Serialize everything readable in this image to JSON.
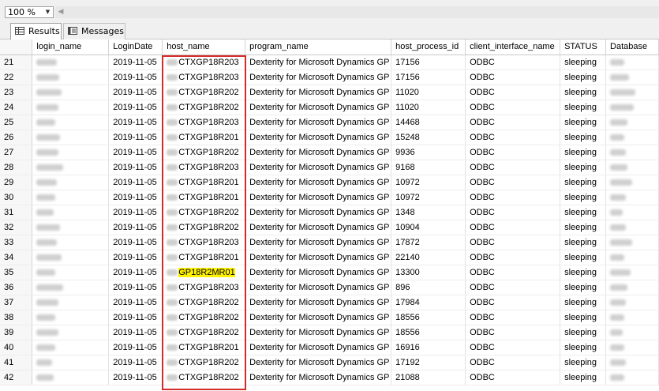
{
  "toolbar": {
    "zoom_value": "100 %"
  },
  "tabs": [
    {
      "label": "Results",
      "icon": "grid-icon"
    },
    {
      "label": "Messages",
      "icon": "messages-icon"
    }
  ],
  "columns": [
    "login_name",
    "LoginDate",
    "host_name",
    "program_name",
    "host_process_id",
    "client_interface_name",
    "STATUS",
    "Database"
  ],
  "rows": [
    {
      "n": "21",
      "date": "2019-11-05",
      "host": "CTXGP18R203",
      "prog": "Dexterity for Microsoft Dynamics GP",
      "pid": "17156",
      "client": "ODBC",
      "status": "sleeping"
    },
    {
      "n": "22",
      "date": "2019-11-05",
      "host": "CTXGP18R203",
      "prog": "Dexterity for Microsoft Dynamics GP",
      "pid": "17156",
      "client": "ODBC",
      "status": "sleeping"
    },
    {
      "n": "23",
      "date": "2019-11-05",
      "host": "CTXGP18R202",
      "prog": "Dexterity for Microsoft Dynamics GP",
      "pid": "11020",
      "client": "ODBC",
      "status": "sleeping"
    },
    {
      "n": "24",
      "date": "2019-11-05",
      "host": "CTXGP18R202",
      "prog": "Dexterity for Microsoft Dynamics GP",
      "pid": "11020",
      "client": "ODBC",
      "status": "sleeping"
    },
    {
      "n": "25",
      "date": "2019-11-05",
      "host": "CTXGP18R203",
      "prog": "Dexterity for Microsoft Dynamics GP",
      "pid": "14468",
      "client": "ODBC",
      "status": "sleeping"
    },
    {
      "n": "26",
      "date": "2019-11-05",
      "host": "CTXGP18R201",
      "prog": "Dexterity for Microsoft Dynamics GP",
      "pid": "15248",
      "client": "ODBC",
      "status": "sleeping"
    },
    {
      "n": "27",
      "date": "2019-11-05",
      "host": "CTXGP18R202",
      "prog": "Dexterity for Microsoft Dynamics GP",
      "pid": "9936",
      "client": "ODBC",
      "status": "sleeping"
    },
    {
      "n": "28",
      "date": "2019-11-05",
      "host": "CTXGP18R203",
      "prog": "Dexterity for Microsoft Dynamics GP",
      "pid": "9168",
      "client": "ODBC",
      "status": "sleeping"
    },
    {
      "n": "29",
      "date": "2019-11-05",
      "host": "CTXGP18R201",
      "prog": "Dexterity for Microsoft Dynamics GP",
      "pid": "10972",
      "client": "ODBC",
      "status": "sleeping"
    },
    {
      "n": "30",
      "date": "2019-11-05",
      "host": "CTXGP18R201",
      "prog": "Dexterity for Microsoft Dynamics GP",
      "pid": "10972",
      "client": "ODBC",
      "status": "sleeping"
    },
    {
      "n": "31",
      "date": "2019-11-05",
      "host": "CTXGP18R202",
      "prog": "Dexterity for Microsoft Dynamics GP",
      "pid": "1348",
      "client": "ODBC",
      "status": "sleeping"
    },
    {
      "n": "32",
      "date": "2019-11-05",
      "host": "CTXGP18R202",
      "prog": "Dexterity for Microsoft Dynamics GP",
      "pid": "10904",
      "client": "ODBC",
      "status": "sleeping"
    },
    {
      "n": "33",
      "date": "2019-11-05",
      "host": "CTXGP18R203",
      "prog": "Dexterity for Microsoft Dynamics GP",
      "pid": "17872",
      "client": "ODBC",
      "status": "sleeping"
    },
    {
      "n": "34",
      "date": "2019-11-05",
      "host": "CTXGP18R201",
      "prog": "Dexterity for Microsoft Dynamics GP",
      "pid": "22140",
      "client": "ODBC",
      "status": "sleeping"
    },
    {
      "n": "35",
      "date": "2019-11-05",
      "host": "GP18R2MR01",
      "prog": "Dexterity for Microsoft Dynamics GP",
      "pid": "13300",
      "client": "ODBC",
      "status": "sleeping",
      "highlight": true
    },
    {
      "n": "36",
      "date": "2019-11-05",
      "host": "CTXGP18R203",
      "prog": "Dexterity for Microsoft Dynamics GP",
      "pid": "896",
      "client": "ODBC",
      "status": "sleeping"
    },
    {
      "n": "37",
      "date": "2019-11-05",
      "host": "CTXGP18R202",
      "prog": "Dexterity for Microsoft Dynamics GP",
      "pid": "17984",
      "client": "ODBC",
      "status": "sleeping"
    },
    {
      "n": "38",
      "date": "2019-11-05",
      "host": "CTXGP18R202",
      "prog": "Dexterity for Microsoft Dynamics GP",
      "pid": "18556",
      "client": "ODBC",
      "status": "sleeping"
    },
    {
      "n": "39",
      "date": "2019-11-05",
      "host": "CTXGP18R202",
      "prog": "Dexterity for Microsoft Dynamics GP",
      "pid": "18556",
      "client": "ODBC",
      "status": "sleeping"
    },
    {
      "n": "40",
      "date": "2019-11-05",
      "host": "CTXGP18R201",
      "prog": "Dexterity for Microsoft Dynamics GP",
      "pid": "16916",
      "client": "ODBC",
      "status": "sleeping"
    },
    {
      "n": "41",
      "date": "2019-11-05",
      "host": "CTXGP18R202",
      "prog": "Dexterity for Microsoft Dynamics GP",
      "pid": "17192",
      "client": "ODBC",
      "status": "sleeping"
    },
    {
      "n": "42",
      "date": "2019-11-05",
      "host": "CTXGP18R202",
      "prog": "Dexterity for Microsoft Dynamics GP",
      "pid": "21088",
      "client": "ODBC",
      "status": "sleeping"
    }
  ],
  "colors": {
    "highlight": "#fff200",
    "annotation_box": "#d52a2a"
  }
}
